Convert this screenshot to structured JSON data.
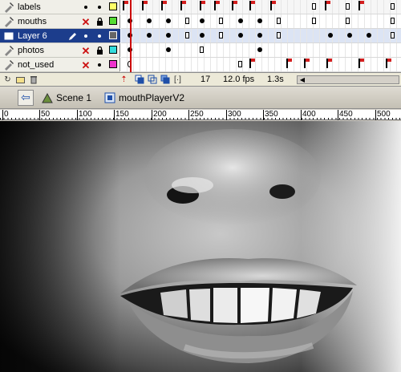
{
  "layers": [
    {
      "name": "labels",
      "visible_icon": "dot-icon",
      "locked_icon": "dot-icon",
      "hidden": false,
      "locked": false,
      "color": "#ffff66",
      "icon": "layer-icon",
      "selected": false
    },
    {
      "name": "mouths",
      "visible_icon": "red-x-icon",
      "locked_icon": "lock-icon",
      "hidden": true,
      "locked": true,
      "color": "#55dd33",
      "icon": "layer-icon",
      "selected": false
    },
    {
      "name": "Layer 6",
      "visible_icon": "dot-icon",
      "locked_icon": "dot-icon",
      "hidden": false,
      "locked": false,
      "color": "#666666",
      "icon": "layer-icon",
      "selected": true,
      "editing": true
    },
    {
      "name": "photos",
      "visible_icon": "red-x-icon",
      "locked_icon": "lock-icon",
      "hidden": true,
      "locked": true,
      "color": "#33dddd",
      "icon": "layer-icon",
      "selected": false
    },
    {
      "name": "not_used",
      "visible_icon": "red-x-icon",
      "locked_icon": "dot-icon",
      "hidden": true,
      "locked": false,
      "color": "#ee33cc",
      "icon": "layer-icon",
      "selected": false
    }
  ],
  "timeline": {
    "current_frame": "17",
    "frame_rate": "12.0 fps",
    "elapsed_time": "1.3s"
  },
  "editbar": {
    "scene": "Scene 1",
    "symbol": "mouthPlayerV2"
  },
  "ruler": {
    "labels": [
      "0",
      "50",
      "100",
      "150",
      "200",
      "250",
      "300",
      "350",
      "400",
      "450",
      "500"
    ]
  },
  "colors": {
    "selection": "#1c3d8c",
    "playhead": "#cc0000",
    "flag": "#d41e1e"
  }
}
